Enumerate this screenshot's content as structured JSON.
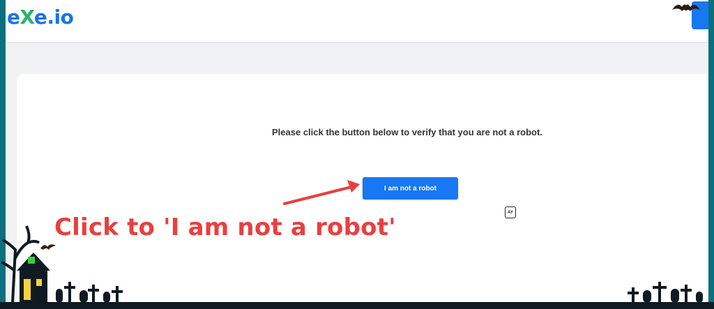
{
  "header": {
    "logo_prefix": "e",
    "logo_x": "X",
    "logo_suffix": "e.io"
  },
  "verify": {
    "message": "Please click the button below to verify that you are not a robot.",
    "button_label": "I am not a robot"
  },
  "annotation": {
    "text": "Click to 'I am not a robot'",
    "color": "#ea3f3f"
  },
  "translate_icon_label": "AY",
  "colors": {
    "brand_blue": "#1877f2",
    "logo_green": "#29b36b",
    "frame_teal": "#0b6f80"
  },
  "icons": [
    "bat-icon",
    "haunted-house-icon",
    "graveyard-icon",
    "translate-icon",
    "arrow-icon"
  ]
}
